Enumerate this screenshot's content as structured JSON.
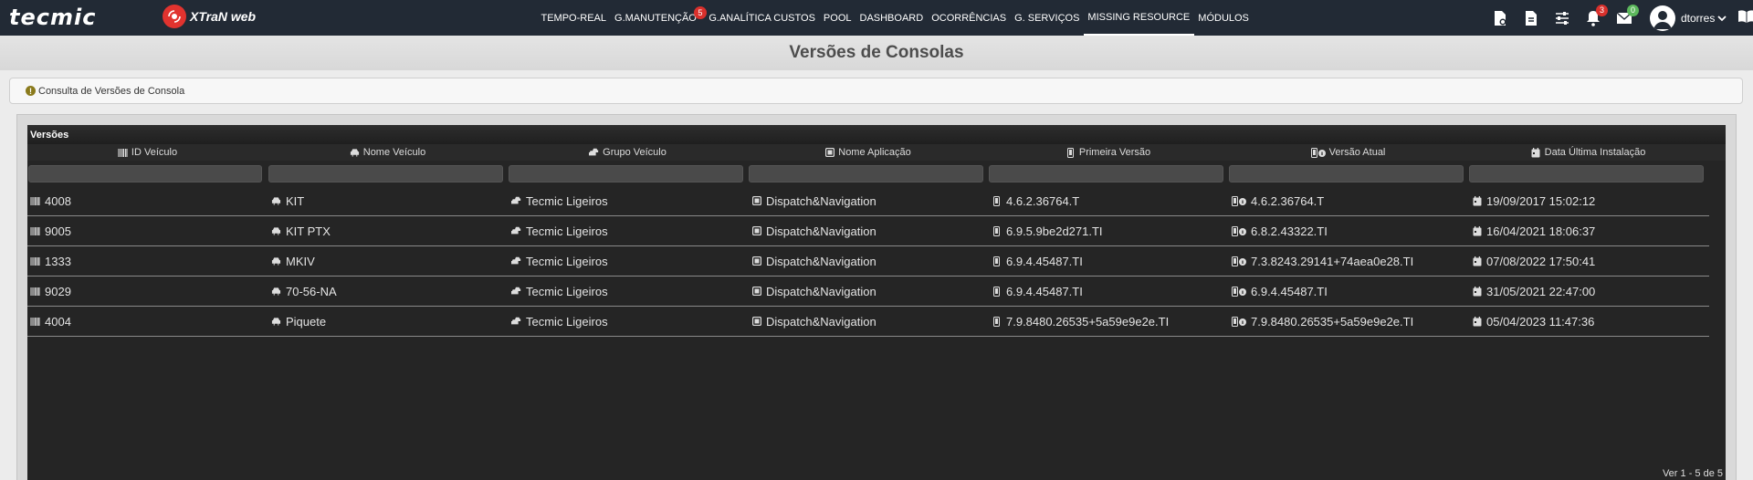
{
  "navbar": {
    "brand": "tecmic",
    "product": "XTraN web",
    "items": [
      {
        "label": "TEMPO-REAL",
        "badge": ""
      },
      {
        "label": "G.MANUTENÇÃO",
        "badge": "5"
      },
      {
        "label": "G.ANALÍTICA CUSTOS",
        "badge": ""
      },
      {
        "label": "POOL",
        "badge": ""
      },
      {
        "label": "DASHBOARD",
        "badge": ""
      },
      {
        "label": "OCORRÊNCIAS",
        "badge": ""
      },
      {
        "label": "G. SERVIÇOS",
        "badge": ""
      },
      {
        "label": "MISSING RESOURCE",
        "badge": "",
        "active": true
      },
      {
        "label": "MÓDULOS",
        "badge": ""
      }
    ],
    "tools": {
      "notifications_badge": "3",
      "messages_badge": "0"
    },
    "user": "dtorres"
  },
  "page": {
    "title": "Versões de Consolas",
    "info": "Consulta de Versões de Consola"
  },
  "grid": {
    "caption": "Versões",
    "columns": [
      {
        "label": "ID Veículo",
        "icon": "barcode-icon"
      },
      {
        "label": "Nome Veículo",
        "icon": "car-icon"
      },
      {
        "label": "Grupo Veículo",
        "icon": "car-group-icon"
      },
      {
        "label": "Nome Aplicação",
        "icon": "app-icon"
      },
      {
        "label": "Primeira Versão",
        "icon": "mobile-icon"
      },
      {
        "label": "Versão Atual",
        "icon": "mobile-info-icon"
      },
      {
        "label": "Data Última Instalação",
        "icon": "calendar-icon"
      }
    ],
    "rows": [
      [
        "4008",
        "KIT",
        "Tecmic Ligeiros",
        "Dispatch&Navigation",
        "4.6.2.36764.T",
        "4.6.2.36764.T",
        "19/09/2017 15:02:12"
      ],
      [
        "9005",
        "KIT PTX",
        "Tecmic Ligeiros",
        "Dispatch&Navigation",
        "6.9.5.9be2d271.TI",
        "6.8.2.43322.TI",
        "16/04/2021 18:06:37"
      ],
      [
        "1333",
        "MKIV",
        "Tecmic Ligeiros",
        "Dispatch&Navigation",
        "6.9.4.45487.TI",
        "7.3.8243.29141+74aea0e28.TI",
        "07/08/2022 17:50:41"
      ],
      [
        "9029",
        "70-56-NA",
        "Tecmic Ligeiros",
        "Dispatch&Navigation",
        "6.9.4.45487.TI",
        "6.9.4.45487.TI",
        "31/05/2021 22:47:00"
      ],
      [
        "4004",
        "Piquete",
        "Tecmic Ligeiros",
        "Dispatch&Navigation",
        "7.9.8480.26535+5a59e9e2e.TI",
        "7.9.8480.26535+5a59e9e2e.TI",
        "05/04/2023 11:47:36"
      ]
    ],
    "pager": "Ver 1 - 5 de 5"
  },
  "colors": {
    "navbar": "#222a35",
    "badge_red": "#d9302c",
    "badge_green": "#5cb85c",
    "grid_bg": "#252525"
  }
}
